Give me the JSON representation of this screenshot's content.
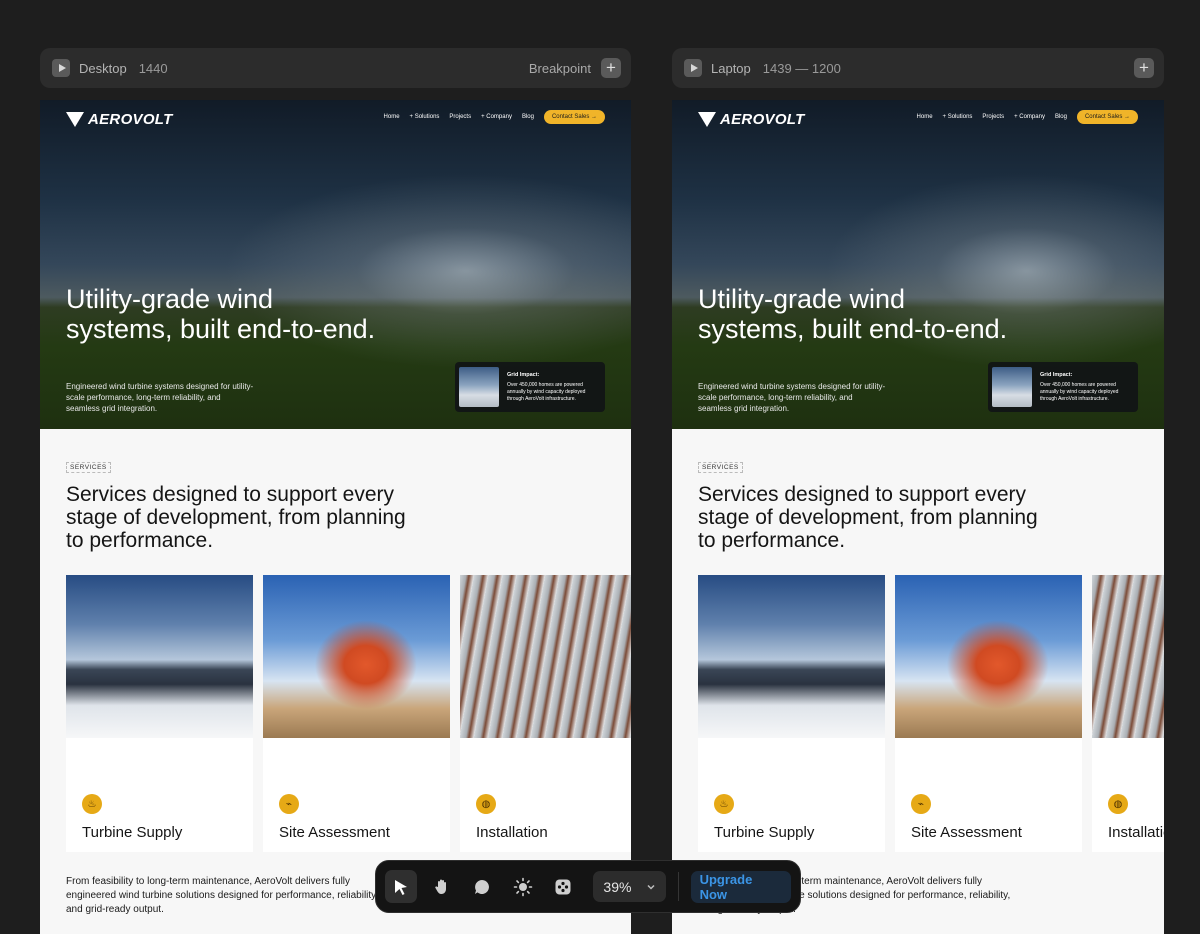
{
  "frames": [
    {
      "name": "Desktop",
      "range": "1440",
      "breakpoint_label": "Breakpoint"
    },
    {
      "name": "Laptop",
      "range": "1439 — 1200",
      "breakpoint_label": ""
    }
  ],
  "site": {
    "brand": "AEROVOLT",
    "nav": [
      "Home",
      "+ Solutions",
      "Projects",
      "+ Company",
      "Blog"
    ],
    "cta": "Contact Sales →",
    "hero_title": "Utility-grade wind systems, built end-to-end.",
    "hero_sub": "Engineered wind turbine systems designed for utility-scale performance, long-term reliability, and seamless grid integration.",
    "grid_title": "Grid Impact:",
    "grid_text": "Over 450,000 homes are powered annually by wind capacity deployed through AeroVolt infrastructure.",
    "services_tag": "SERVICES",
    "services_title": "Services designed to support every stage of development, from planning to performance.",
    "cards": [
      {
        "title": "Turbine Supply",
        "icon": "flame-icon"
      },
      {
        "title": "Site Assessment",
        "icon": "wind-icon"
      },
      {
        "title": "Installation",
        "icon": "drop-icon"
      }
    ],
    "body": "From feasibility to long-term maintenance, AeroVolt delivers fully engineered wind turbine solutions designed for performance, reliability, and grid-ready output."
  },
  "toolbar": {
    "tools": [
      "pointer-icon",
      "hand-icon",
      "comment-icon",
      "sun-icon",
      "component-icon"
    ],
    "zoom": "39%",
    "upgrade": "Upgrade Now"
  }
}
